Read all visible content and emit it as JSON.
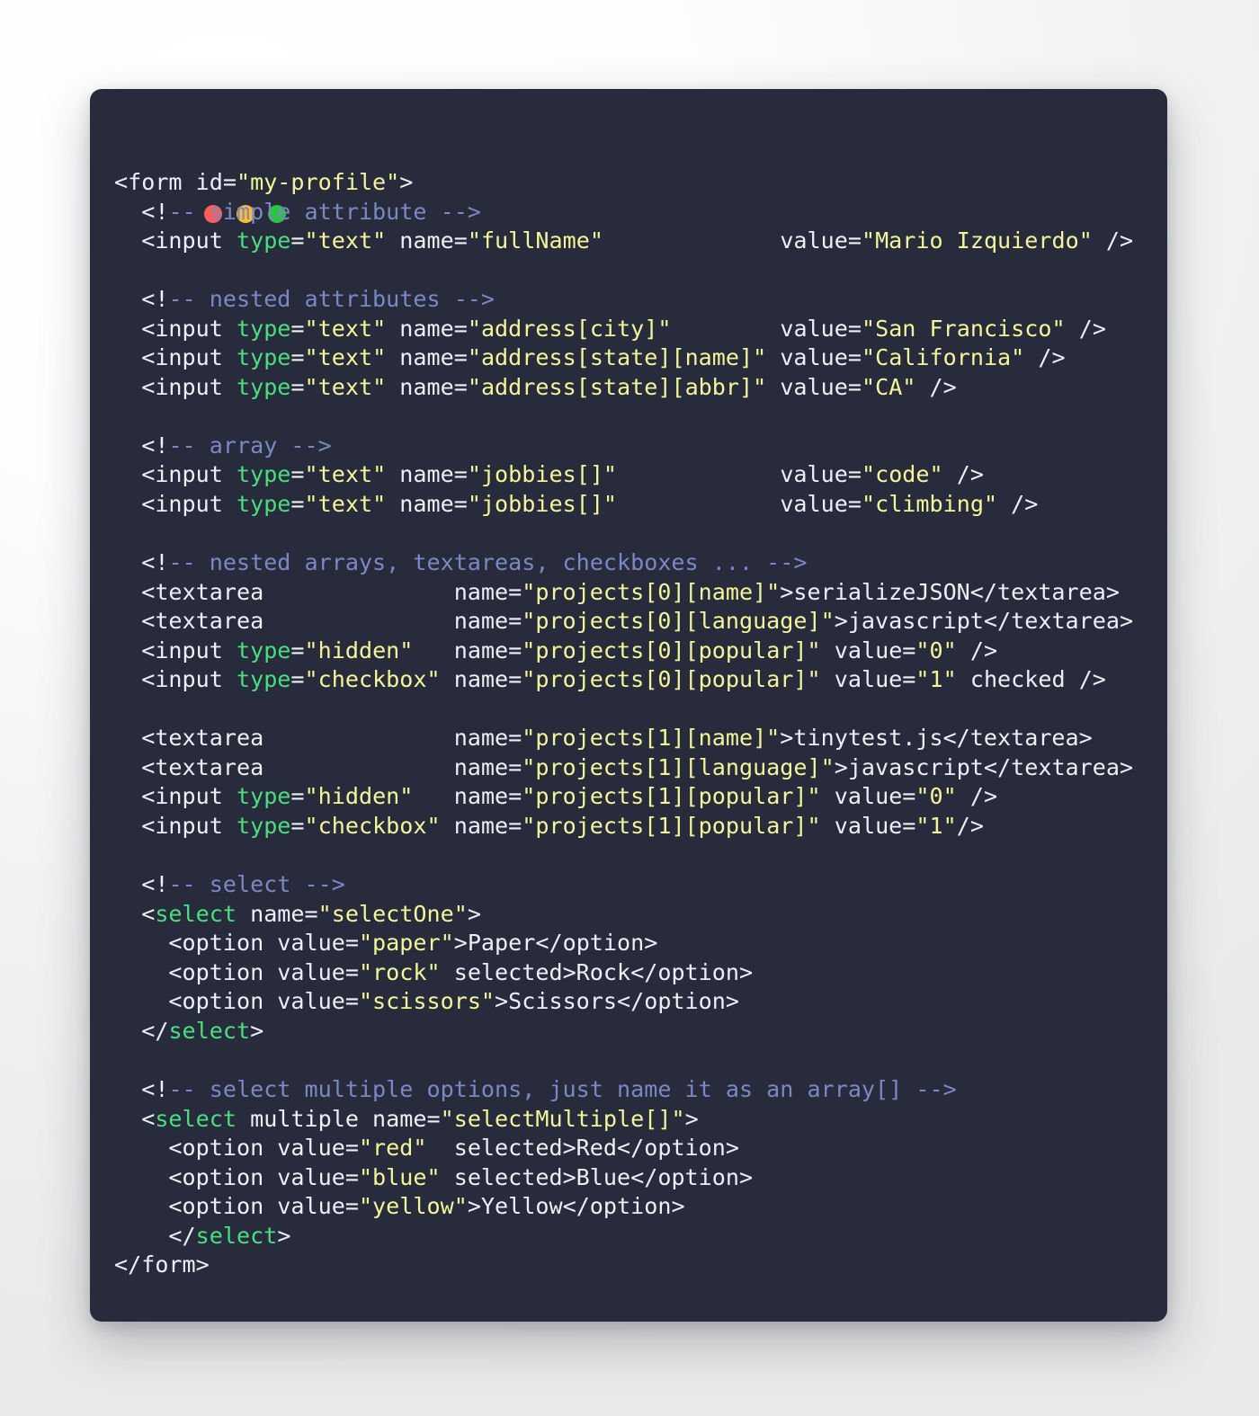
{
  "window": {
    "traffic_lights": [
      {
        "name": "close",
        "color": "#fc5f57"
      },
      {
        "name": "minimize",
        "color": "#fbbd2d"
      },
      {
        "name": "maximize",
        "color": "#26c73f"
      }
    ],
    "background": "#272b3b",
    "page_background": "#f2f2f2"
  },
  "theme": {
    "plain": "#eceff4",
    "tag": "#4ade80",
    "string": "#f2f59a",
    "comment": "#7b88c4"
  },
  "code": {
    "language": "html",
    "lines": [
      [
        {
          "t": "<form id=",
          "c": "pl"
        },
        {
          "t": "\"my-profile\"",
          "c": "str"
        },
        {
          "t": ">",
          "c": "pl"
        }
      ],
      [
        {
          "t": "  <!",
          "c": "pl"
        },
        {
          "t": "-- simple attribute -->",
          "c": "cmt"
        }
      ],
      [
        {
          "t": "  <input ",
          "c": "pl"
        },
        {
          "t": "type",
          "c": "tag"
        },
        {
          "t": "=",
          "c": "pl"
        },
        {
          "t": "\"text\"",
          "c": "str"
        },
        {
          "t": " name=",
          "c": "pl"
        },
        {
          "t": "\"fullName\"",
          "c": "str"
        },
        {
          "t": "             value=",
          "c": "pl"
        },
        {
          "t": "\"Mario Izquierdo\"",
          "c": "str"
        },
        {
          "t": " />",
          "c": "pl"
        }
      ],
      [],
      [
        {
          "t": "  <!",
          "c": "pl"
        },
        {
          "t": "-- nested attributes -->",
          "c": "cmt"
        }
      ],
      [
        {
          "t": "  <input ",
          "c": "pl"
        },
        {
          "t": "type",
          "c": "tag"
        },
        {
          "t": "=",
          "c": "pl"
        },
        {
          "t": "\"text\"",
          "c": "str"
        },
        {
          "t": " name=",
          "c": "pl"
        },
        {
          "t": "\"address[city]\"",
          "c": "str"
        },
        {
          "t": "        value=",
          "c": "pl"
        },
        {
          "t": "\"San Francisco\"",
          "c": "str"
        },
        {
          "t": " />",
          "c": "pl"
        }
      ],
      [
        {
          "t": "  <input ",
          "c": "pl"
        },
        {
          "t": "type",
          "c": "tag"
        },
        {
          "t": "=",
          "c": "pl"
        },
        {
          "t": "\"text\"",
          "c": "str"
        },
        {
          "t": " name=",
          "c": "pl"
        },
        {
          "t": "\"address[state][name]\"",
          "c": "str"
        },
        {
          "t": " value=",
          "c": "pl"
        },
        {
          "t": "\"California\"",
          "c": "str"
        },
        {
          "t": " />",
          "c": "pl"
        }
      ],
      [
        {
          "t": "  <input ",
          "c": "pl"
        },
        {
          "t": "type",
          "c": "tag"
        },
        {
          "t": "=",
          "c": "pl"
        },
        {
          "t": "\"text\"",
          "c": "str"
        },
        {
          "t": " name=",
          "c": "pl"
        },
        {
          "t": "\"address[state][abbr]\"",
          "c": "str"
        },
        {
          "t": " value=",
          "c": "pl"
        },
        {
          "t": "\"CA\"",
          "c": "str"
        },
        {
          "t": " />",
          "c": "pl"
        }
      ],
      [],
      [
        {
          "t": "  <!",
          "c": "pl"
        },
        {
          "t": "-- array -->",
          "c": "cmt"
        }
      ],
      [
        {
          "t": "  <input ",
          "c": "pl"
        },
        {
          "t": "type",
          "c": "tag"
        },
        {
          "t": "=",
          "c": "pl"
        },
        {
          "t": "\"text\"",
          "c": "str"
        },
        {
          "t": " name=",
          "c": "pl"
        },
        {
          "t": "\"jobbies[]\"",
          "c": "str"
        },
        {
          "t": "            value=",
          "c": "pl"
        },
        {
          "t": "\"code\"",
          "c": "str"
        },
        {
          "t": " />",
          "c": "pl"
        }
      ],
      [
        {
          "t": "  <input ",
          "c": "pl"
        },
        {
          "t": "type",
          "c": "tag"
        },
        {
          "t": "=",
          "c": "pl"
        },
        {
          "t": "\"text\"",
          "c": "str"
        },
        {
          "t": " name=",
          "c": "pl"
        },
        {
          "t": "\"jobbies[]\"",
          "c": "str"
        },
        {
          "t": "            value=",
          "c": "pl"
        },
        {
          "t": "\"climbing\"",
          "c": "str"
        },
        {
          "t": " />",
          "c": "pl"
        }
      ],
      [],
      [
        {
          "t": "  <!",
          "c": "pl"
        },
        {
          "t": "-- nested arrays, textareas, checkboxes ... -->",
          "c": "cmt"
        }
      ],
      [
        {
          "t": "  <textarea              name=",
          "c": "pl"
        },
        {
          "t": "\"projects[0][name]\"",
          "c": "str"
        },
        {
          "t": ">serializeJSON</textarea>",
          "c": "pl"
        }
      ],
      [
        {
          "t": "  <textarea              name=",
          "c": "pl"
        },
        {
          "t": "\"projects[0][language]\"",
          "c": "str"
        },
        {
          "t": ">javascript</textarea>",
          "c": "pl"
        }
      ],
      [
        {
          "t": "  <input ",
          "c": "pl"
        },
        {
          "t": "type",
          "c": "tag"
        },
        {
          "t": "=",
          "c": "pl"
        },
        {
          "t": "\"hidden\"",
          "c": "str"
        },
        {
          "t": "   name=",
          "c": "pl"
        },
        {
          "t": "\"projects[0][popular]\"",
          "c": "str"
        },
        {
          "t": " value=",
          "c": "pl"
        },
        {
          "t": "\"0\"",
          "c": "str"
        },
        {
          "t": " />",
          "c": "pl"
        }
      ],
      [
        {
          "t": "  <input ",
          "c": "pl"
        },
        {
          "t": "type",
          "c": "tag"
        },
        {
          "t": "=",
          "c": "pl"
        },
        {
          "t": "\"checkbox\"",
          "c": "str"
        },
        {
          "t": " name=",
          "c": "pl"
        },
        {
          "t": "\"projects[0][popular]\"",
          "c": "str"
        },
        {
          "t": " value=",
          "c": "pl"
        },
        {
          "t": "\"1\"",
          "c": "str"
        },
        {
          "t": " checked />",
          "c": "pl"
        }
      ],
      [],
      [
        {
          "t": "  <textarea              name=",
          "c": "pl"
        },
        {
          "t": "\"projects[1][name]\"",
          "c": "str"
        },
        {
          "t": ">tinytest.js</textarea>",
          "c": "pl"
        }
      ],
      [
        {
          "t": "  <textarea              name=",
          "c": "pl"
        },
        {
          "t": "\"projects[1][language]\"",
          "c": "str"
        },
        {
          "t": ">javascript</textarea>",
          "c": "pl"
        }
      ],
      [
        {
          "t": "  <input ",
          "c": "pl"
        },
        {
          "t": "type",
          "c": "tag"
        },
        {
          "t": "=",
          "c": "pl"
        },
        {
          "t": "\"hidden\"",
          "c": "str"
        },
        {
          "t": "   name=",
          "c": "pl"
        },
        {
          "t": "\"projects[1][popular]\"",
          "c": "str"
        },
        {
          "t": " value=",
          "c": "pl"
        },
        {
          "t": "\"0\"",
          "c": "str"
        },
        {
          "t": " />",
          "c": "pl"
        }
      ],
      [
        {
          "t": "  <input ",
          "c": "pl"
        },
        {
          "t": "type",
          "c": "tag"
        },
        {
          "t": "=",
          "c": "pl"
        },
        {
          "t": "\"checkbox\"",
          "c": "str"
        },
        {
          "t": " name=",
          "c": "pl"
        },
        {
          "t": "\"projects[1][popular]\"",
          "c": "str"
        },
        {
          "t": " value=",
          "c": "pl"
        },
        {
          "t": "\"1\"",
          "c": "str"
        },
        {
          "t": "/>",
          "c": "pl"
        }
      ],
      [],
      [
        {
          "t": "  <!",
          "c": "pl"
        },
        {
          "t": "-- select -->",
          "c": "cmt"
        }
      ],
      [
        {
          "t": "  <",
          "c": "pl"
        },
        {
          "t": "select",
          "c": "tag"
        },
        {
          "t": " name=",
          "c": "pl"
        },
        {
          "t": "\"selectOne\"",
          "c": "str"
        },
        {
          "t": ">",
          "c": "pl"
        }
      ],
      [
        {
          "t": "    <option value=",
          "c": "pl"
        },
        {
          "t": "\"paper\"",
          "c": "str"
        },
        {
          "t": ">Paper</option>",
          "c": "pl"
        }
      ],
      [
        {
          "t": "    <option value=",
          "c": "pl"
        },
        {
          "t": "\"rock\"",
          "c": "str"
        },
        {
          "t": " selected>Rock</option>",
          "c": "pl"
        }
      ],
      [
        {
          "t": "    <option value=",
          "c": "pl"
        },
        {
          "t": "\"scissors\"",
          "c": "str"
        },
        {
          "t": ">Scissors</option>",
          "c": "pl"
        }
      ],
      [
        {
          "t": "  </",
          "c": "pl"
        },
        {
          "t": "select",
          "c": "tag"
        },
        {
          "t": ">",
          "c": "pl"
        }
      ],
      [],
      [
        {
          "t": "  <!",
          "c": "pl"
        },
        {
          "t": "-- select multiple options, just name it as an array[] -->",
          "c": "cmt"
        }
      ],
      [
        {
          "t": "  <",
          "c": "pl"
        },
        {
          "t": "select",
          "c": "tag"
        },
        {
          "t": " multiple name=",
          "c": "pl"
        },
        {
          "t": "\"selectMultiple[]\"",
          "c": "str"
        },
        {
          "t": ">",
          "c": "pl"
        }
      ],
      [
        {
          "t": "    <option value=",
          "c": "pl"
        },
        {
          "t": "\"red\"",
          "c": "str"
        },
        {
          "t": "  selected>Red</option>",
          "c": "pl"
        }
      ],
      [
        {
          "t": "    <option value=",
          "c": "pl"
        },
        {
          "t": "\"blue\"",
          "c": "str"
        },
        {
          "t": " selected>Blue</option>",
          "c": "pl"
        }
      ],
      [
        {
          "t": "    <option value=",
          "c": "pl"
        },
        {
          "t": "\"yellow\"",
          "c": "str"
        },
        {
          "t": ">Yellow</option>",
          "c": "pl"
        }
      ],
      [
        {
          "t": "    </",
          "c": "pl"
        },
        {
          "t": "select",
          "c": "tag"
        },
        {
          "t": ">",
          "c": "pl"
        }
      ],
      [
        {
          "t": "</form>",
          "c": "pl"
        }
      ]
    ],
    "plain_text": "<form id=\"my-profile\">\n  <!-- simple attribute -->\n  <input type=\"text\" name=\"fullName\"             value=\"Mario Izquierdo\" />\n\n  <!-- nested attributes -->\n  <input type=\"text\" name=\"address[city]\"        value=\"San Francisco\" />\n  <input type=\"text\" name=\"address[state][name]\" value=\"California\" />\n  <input type=\"text\" name=\"address[state][abbr]\" value=\"CA\" />\n\n  <!-- array -->\n  <input type=\"text\" name=\"jobbies[]\"            value=\"code\" />\n  <input type=\"text\" name=\"jobbies[]\"            value=\"climbing\" />\n\n  <!-- nested arrays, textareas, checkboxes ... -->\n  <textarea              name=\"projects[0][name]\">serializeJSON</textarea>\n  <textarea              name=\"projects[0][language]\">javascript</textarea>\n  <input type=\"hidden\"   name=\"projects[0][popular]\" value=\"0\" />\n  <input type=\"checkbox\" name=\"projects[0][popular]\" value=\"1\" checked />\n\n  <textarea              name=\"projects[1][name]\">tinytest.js</textarea>\n  <textarea              name=\"projects[1][language]\">javascript</textarea>\n  <input type=\"hidden\"   name=\"projects[1][popular]\" value=\"0\" />\n  <input type=\"checkbox\" name=\"projects[1][popular]\" value=\"1\"/>\n\n  <!-- select -->\n  <select name=\"selectOne\">\n    <option value=\"paper\">Paper</option>\n    <option value=\"rock\" selected>Rock</option>\n    <option value=\"scissors\">Scissors</option>\n  </select>\n\n  <!-- select multiple options, just name it as an array[] -->\n  <select multiple name=\"selectMultiple[]\">\n    <option value=\"red\"  selected>Red</option>\n    <option value=\"blue\" selected>Blue</option>\n    <option value=\"yellow\">Yellow</option>\n    </select>\n</form>"
  }
}
